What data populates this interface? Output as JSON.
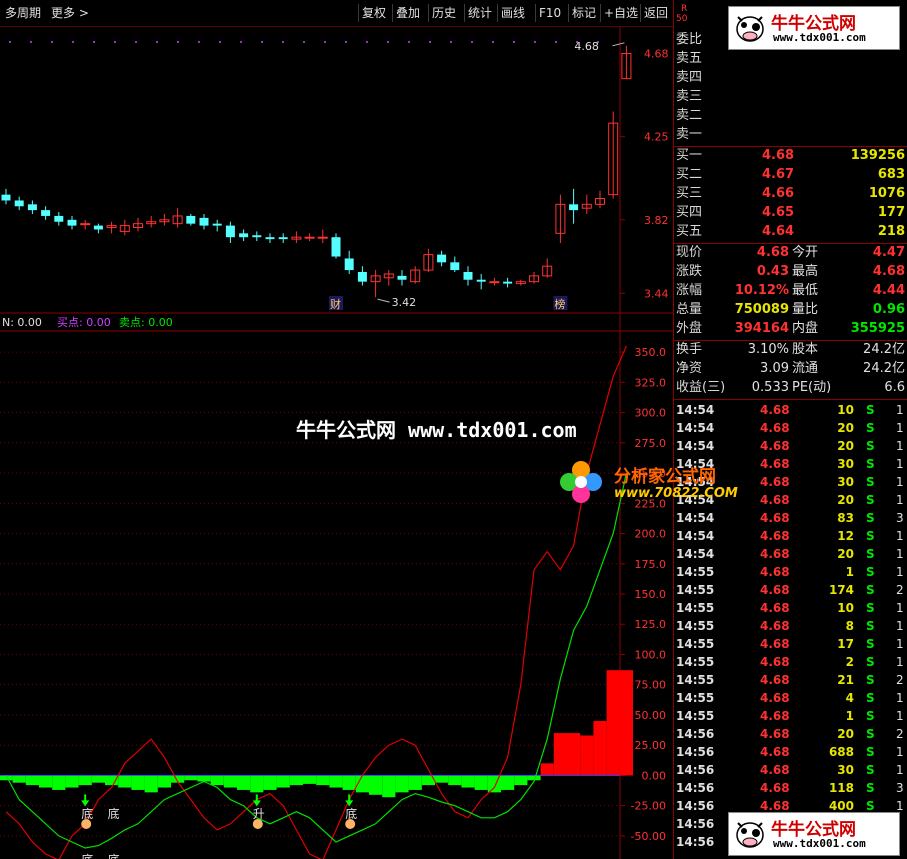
{
  "toolbar": {
    "period": "多周期",
    "more": "更多",
    "buttons": [
      "复权",
      "叠加",
      "历史",
      "统计",
      "画线",
      "F10",
      "标记",
      "+自选",
      "返回"
    ]
  },
  "chart": {
    "price_axis": [
      "4.68",
      "4.25",
      "3.82",
      "3.44"
    ],
    "indicator_axis": [
      "350.0",
      "325.0",
      "300.0",
      "275.0",
      "250.0",
      "225.0",
      "200.0",
      "175.0",
      "150.0",
      "125.0",
      "100.0",
      "75.00",
      "50.00",
      "25.00",
      "0.00",
      "-25.00",
      "-50.00"
    ],
    "high_label": "4.68",
    "low_label": "3.42",
    "events": [
      "财",
      "榜"
    ],
    "indicator_legend": [
      {
        "label": "N: 0.00",
        "color": "#e0e0e0"
      },
      {
        "label": "买点: 0.00",
        "color": "#d040ff"
      },
      {
        "label": "卖点: 0.00",
        "color": "#00e600"
      }
    ],
    "signal_labels": [
      "底",
      "底",
      "升",
      "底",
      "底",
      "底"
    ],
    "colors": {
      "up": "#ff3232",
      "down": "#54ffff",
      "red_line": "#e00000",
      "green_line": "#00e000",
      "bar_green": "#00ff00",
      "bar_red": "#ff0000",
      "grid": "#8b0000"
    }
  },
  "chart_data": {
    "type": "bar",
    "candles": {
      "open": [
        3.95,
        3.92,
        3.9,
        3.87,
        3.84,
        3.82,
        3.8,
        3.79,
        3.78,
        3.76,
        3.78,
        3.8,
        3.81,
        3.8,
        3.84,
        3.83,
        3.8,
        3.79,
        3.75,
        3.74,
        3.73,
        3.73,
        3.72,
        3.73,
        3.73,
        3.73,
        3.62,
        3.55,
        3.5,
        3.52,
        3.53,
        3.5,
        3.56,
        3.64,
        3.6,
        3.55,
        3.51,
        3.5,
        3.5,
        3.49,
        3.5,
        3.53,
        3.75,
        3.9,
        3.88,
        3.9,
        3.95,
        4.55
      ],
      "close": [
        3.92,
        3.89,
        3.87,
        3.84,
        3.81,
        3.79,
        3.8,
        3.77,
        3.79,
        3.79,
        3.8,
        3.81,
        3.82,
        3.84,
        3.8,
        3.79,
        3.79,
        3.73,
        3.73,
        3.73,
        3.72,
        3.72,
        3.73,
        3.73,
        3.73,
        3.63,
        3.56,
        3.5,
        3.53,
        3.54,
        3.51,
        3.56,
        3.64,
        3.6,
        3.56,
        3.51,
        3.5,
        3.5,
        3.49,
        3.5,
        3.53,
        3.58,
        3.9,
        3.87,
        3.9,
        3.93,
        4.32,
        4.68
      ],
      "high": [
        3.98,
        3.94,
        3.92,
        3.89,
        3.86,
        3.84,
        3.82,
        3.8,
        3.81,
        3.82,
        3.83,
        3.84,
        3.85,
        3.88,
        3.85,
        3.85,
        3.82,
        3.81,
        3.77,
        3.76,
        3.75,
        3.75,
        3.76,
        3.75,
        3.77,
        3.75,
        3.66,
        3.58,
        3.56,
        3.56,
        3.56,
        3.58,
        3.67,
        3.66,
        3.63,
        3.58,
        3.54,
        3.52,
        3.52,
        3.51,
        3.55,
        3.62,
        3.95,
        3.98,
        3.95,
        3.97,
        4.38,
        4.72
      ],
      "low": [
        3.9,
        3.87,
        3.85,
        3.82,
        3.79,
        3.77,
        3.77,
        3.75,
        3.75,
        3.74,
        3.76,
        3.78,
        3.79,
        3.78,
        3.79,
        3.77,
        3.76,
        3.7,
        3.71,
        3.71,
        3.7,
        3.7,
        3.7,
        3.71,
        3.7,
        3.62,
        3.54,
        3.48,
        3.42,
        3.48,
        3.48,
        3.49,
        3.55,
        3.58,
        3.55,
        3.48,
        3.46,
        3.48,
        3.47,
        3.48,
        3.49,
        3.52,
        3.7,
        3.8,
        3.85,
        3.88,
        3.93,
        4.55
      ]
    },
    "histogram": [
      -4,
      -6,
      -8,
      -10,
      -12,
      -10,
      -8,
      -6,
      -8,
      -10,
      -12,
      -14,
      -10,
      -6,
      -4,
      -5,
      -8,
      -10,
      -12,
      -14,
      -12,
      -10,
      -8,
      -7,
      -8,
      -10,
      -12,
      -14,
      -16,
      -18,
      -14,
      -12,
      -8,
      -6,
      -8,
      -10,
      -12,
      -14,
      -12,
      -8,
      -4,
      10,
      35,
      35,
      33,
      45,
      87,
      87
    ],
    "red_line": [
      -30,
      -40,
      -55,
      -65,
      -70,
      -50,
      -40,
      -20,
      -10,
      10,
      20,
      30,
      15,
      -5,
      -20,
      -35,
      -45,
      -40,
      -30,
      -20,
      -15,
      -25,
      -45,
      -65,
      -70,
      -45,
      -20,
      0,
      15,
      25,
      30,
      25,
      5,
      -15,
      -30,
      -35,
      -20,
      -10,
      15,
      75,
      170,
      185,
      170,
      190,
      250,
      290,
      330,
      355
    ],
    "green_line": [
      0,
      -20,
      -30,
      -40,
      -50,
      -55,
      -60,
      -58,
      -52,
      -45,
      -40,
      -30,
      -20,
      -15,
      -10,
      -5,
      -10,
      -20,
      -25,
      -35,
      -40,
      -35,
      -30,
      -35,
      -45,
      -55,
      -50,
      -45,
      -40,
      -30,
      -20,
      -15,
      -18,
      -22,
      -25,
      -30,
      -35,
      -35,
      -30,
      -20,
      -5,
      30,
      80,
      120,
      140,
      170,
      200,
      250
    ],
    "ylim": [
      -60,
      360
    ],
    "price_ylim": [
      3.4,
      4.75
    ]
  },
  "quote": {
    "weibi": "委比",
    "asks": [
      {
        "label": "卖五"
      },
      {
        "label": "卖四"
      },
      {
        "label": "卖三"
      },
      {
        "label": "卖二"
      },
      {
        "label": "卖一"
      }
    ],
    "bids": [
      {
        "label": "买一",
        "price": "4.68",
        "vol": "139256"
      },
      {
        "label": "买二",
        "price": "4.67",
        "vol": "683"
      },
      {
        "label": "买三",
        "price": "4.66",
        "vol": "1076"
      },
      {
        "label": "买四",
        "price": "4.65",
        "vol": "177"
      },
      {
        "label": "买五",
        "price": "4.64",
        "vol": "218"
      }
    ],
    "stats": [
      {
        "l1": "现价",
        "v1": "4.68",
        "c1": "red",
        "l2": "今开",
        "v2": "4.47",
        "c2": "red"
      },
      {
        "l1": "涨跌",
        "v1": "0.43",
        "c1": "red",
        "l2": "最高",
        "v2": "4.68",
        "c2": "red"
      },
      {
        "l1": "涨幅",
        "v1": "10.12%",
        "c1": "red",
        "l2": "最低",
        "v2": "4.44",
        "c2": "red"
      },
      {
        "l1": "总量",
        "v1": "750089",
        "c1": "yellow",
        "l2": "量比",
        "v2": "0.96",
        "c2": "green"
      },
      {
        "l1": "外盘",
        "v1": "394164",
        "c1": "red",
        "l2": "内盘",
        "v2": "355925",
        "c2": "green"
      }
    ],
    "fund": [
      {
        "l1": "换手",
        "v1": "3.10%",
        "l2": "股本",
        "v2": "24.2亿"
      },
      {
        "l1": "净资",
        "v1": "3.09",
        "l2": "流通",
        "v2": "24.2亿"
      },
      {
        "l1": "收益(三)",
        "v1": "0.533",
        "l2": "PE(动)",
        "v2": "6.6"
      }
    ]
  },
  "ticks": [
    {
      "t": "14:54",
      "p": "4.68",
      "v": "10",
      "bs": "S",
      "n": "1"
    },
    {
      "t": "14:54",
      "p": "4.68",
      "v": "20",
      "bs": "S",
      "n": "1"
    },
    {
      "t": "14:54",
      "p": "4.68",
      "v": "20",
      "bs": "S",
      "n": "1"
    },
    {
      "t": "14:54",
      "p": "4.68",
      "v": "30",
      "bs": "S",
      "n": "1"
    },
    {
      "t": "14:54",
      "p": "4.68",
      "v": "30",
      "bs": "S",
      "n": "1"
    },
    {
      "t": "14:54",
      "p": "4.68",
      "v": "20",
      "bs": "S",
      "n": "1"
    },
    {
      "t": "14:54",
      "p": "4.68",
      "v": "83",
      "bs": "S",
      "n": "3"
    },
    {
      "t": "14:54",
      "p": "4.68",
      "v": "12",
      "bs": "S",
      "n": "1"
    },
    {
      "t": "14:54",
      "p": "4.68",
      "v": "20",
      "bs": "S",
      "n": "1"
    },
    {
      "t": "14:55",
      "p": "4.68",
      "v": "1",
      "bs": "S",
      "n": "1"
    },
    {
      "t": "14:55",
      "p": "4.68",
      "v": "174",
      "bs": "S",
      "n": "2"
    },
    {
      "t": "14:55",
      "p": "4.68",
      "v": "10",
      "bs": "S",
      "n": "1"
    },
    {
      "t": "14:55",
      "p": "4.68",
      "v": "8",
      "bs": "S",
      "n": "1"
    },
    {
      "t": "14:55",
      "p": "4.68",
      "v": "17",
      "bs": "S",
      "n": "1"
    },
    {
      "t": "14:55",
      "p": "4.68",
      "v": "2",
      "bs": "S",
      "n": "1"
    },
    {
      "t": "14:55",
      "p": "4.68",
      "v": "21",
      "bs": "S",
      "n": "2"
    },
    {
      "t": "14:55",
      "p": "4.68",
      "v": "4",
      "bs": "S",
      "n": "1"
    },
    {
      "t": "14:55",
      "p": "4.68",
      "v": "1",
      "bs": "S",
      "n": "1"
    },
    {
      "t": "14:56",
      "p": "4.68",
      "v": "20",
      "bs": "S",
      "n": "2"
    },
    {
      "t": "14:56",
      "p": "4.68",
      "v": "688",
      "bs": "S",
      "n": "1",
      "vc": "purple"
    },
    {
      "t": "14:56",
      "p": "4.68",
      "v": "30",
      "bs": "S",
      "n": "1"
    },
    {
      "t": "14:56",
      "p": "4.68",
      "v": "118",
      "bs": "S",
      "n": "3"
    },
    {
      "t": "14:56",
      "p": "4.68",
      "v": "400",
      "bs": "S",
      "n": "1"
    },
    {
      "t": "14:56",
      "p": "4.68",
      "v": "",
      "bs": "",
      "n": ""
    },
    {
      "t": "14:56",
      "p": "",
      "v": "",
      "bs": "",
      "n": ""
    }
  ],
  "watermarks": {
    "brand": "牛牛公式网",
    "url": "www.tdx001.com",
    "center": "牛牛公式网 www.tdx001.com",
    "logo2_name": "分析家公式网",
    "logo2_url": "www.70822.COM"
  }
}
